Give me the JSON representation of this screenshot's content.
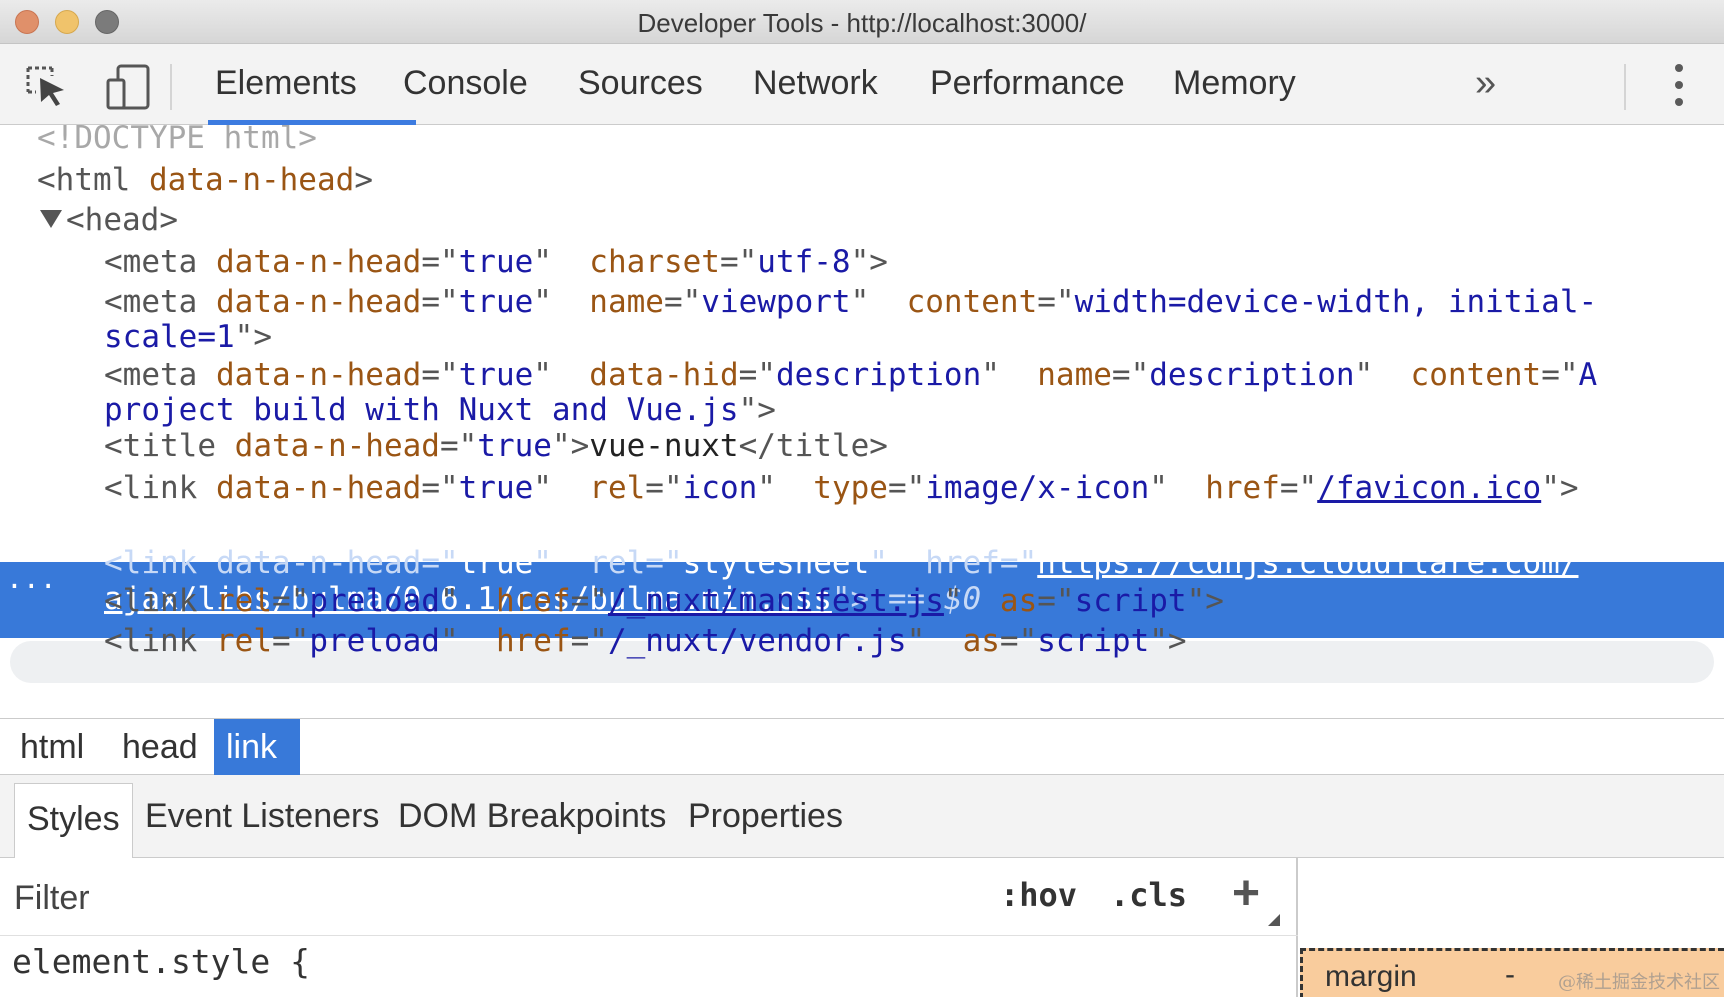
{
  "window": {
    "title": "Developer Tools - http://localhost:3000/"
  },
  "toolbar": {
    "inspect_icon": "inspect-element-icon",
    "device_icon": "device-toolbar-icon",
    "tabs": [
      "Elements",
      "Console",
      "Sources",
      "Network",
      "Performance",
      "Memory"
    ],
    "active_tab": "Elements",
    "more_tabs": "»",
    "menu_icon": "kebab-menu-icon"
  },
  "dom": {
    "doctype": "<!DOCTYPE html>",
    "html_open": "<html",
    "html_attr": "data-n-head",
    "html_close": ">",
    "head_tag": "<head>",
    "meta_open": "<meta",
    "link_open": "<link",
    "title_open": "<title",
    "attr_data_n_head": "data-n-head",
    "val_true": "true",
    "attr_charset": "charset",
    "val_charset": "utf-8",
    "attr_name": "name",
    "val_viewport": "viewport",
    "attr_content": "content",
    "val_viewport_content_1": "width=device-width, initial-",
    "val_viewport_content_2": "scale=1",
    "attr_data_hid": "data-hid",
    "val_description": "description",
    "val_desc_content_1": "A",
    "val_desc_content_2": "project build with Nuxt and Vue.js",
    "title_text": "vue-nuxt",
    "title_close": "</title>",
    "attr_rel": "rel",
    "val_icon": "icon",
    "attr_type": "type",
    "val_type_icon": "image/x-icon",
    "attr_href": "href",
    "val_favicon": "/favicon.ico",
    "val_stylesheet": "stylesheet",
    "val_bulma_1": "https://cdnjs.cloudflare.com/",
    "val_bulma_2": "ajax/libs/bulma/0.6.1/css/bulma.min.css",
    "selected_marker": "== $0",
    "val_preload": "preload",
    "val_manifest": "/_nuxt/manifest.js",
    "attr_as": "as",
    "val_script": "script",
    "val_vendor": "/_nuxt/vendor.js",
    "ellipsis": "..."
  },
  "breadcrumb": [
    "html",
    "head",
    "link"
  ],
  "subtabs": [
    "Styles",
    "Event Listeners",
    "DOM Breakpoints",
    "Properties"
  ],
  "styles": {
    "filter_placeholder": "Filter",
    "hov": ":hov",
    "cls": ".cls",
    "add": "+",
    "element_style": "element.style {"
  },
  "box_model": {
    "margin_label": "margin",
    "margin_value": "-"
  },
  "watermark": "@稀土掘金技术社区",
  "colors": {
    "selection": "#3879d9",
    "tab_underline": "#3c7be0",
    "margin_box": "#f9cc9d"
  }
}
